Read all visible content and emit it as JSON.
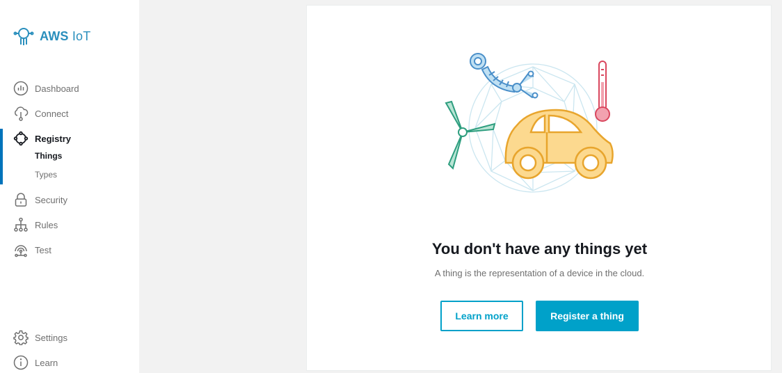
{
  "app": {
    "logo_text_bold": "AWS",
    "logo_text_light": "IoT"
  },
  "sidebar": {
    "items": [
      {
        "label": "Dashboard",
        "icon": "dashboard-icon"
      },
      {
        "label": "Connect",
        "icon": "cloud-connect-icon"
      },
      {
        "label": "Registry",
        "icon": "registry-icon",
        "active": true,
        "subitems": [
          {
            "label": "Things",
            "selected": true
          },
          {
            "label": "Types"
          }
        ]
      },
      {
        "label": "Security",
        "icon": "lock-icon"
      },
      {
        "label": "Rules",
        "icon": "rules-icon"
      },
      {
        "label": "Test",
        "icon": "test-icon"
      }
    ],
    "footer": [
      {
        "label": "Settings",
        "icon": "gear-icon"
      },
      {
        "label": "Learn",
        "icon": "info-icon"
      }
    ]
  },
  "empty_state": {
    "title": "You don't have any things yet",
    "subtitle": "A thing is the representation of a device in the cloud.",
    "learn_more": "Learn more",
    "register": "Register a thing"
  },
  "colors": {
    "accent": "#00a1c9",
    "active_bar": "#0073bb",
    "logo": "#2a8fbd"
  }
}
